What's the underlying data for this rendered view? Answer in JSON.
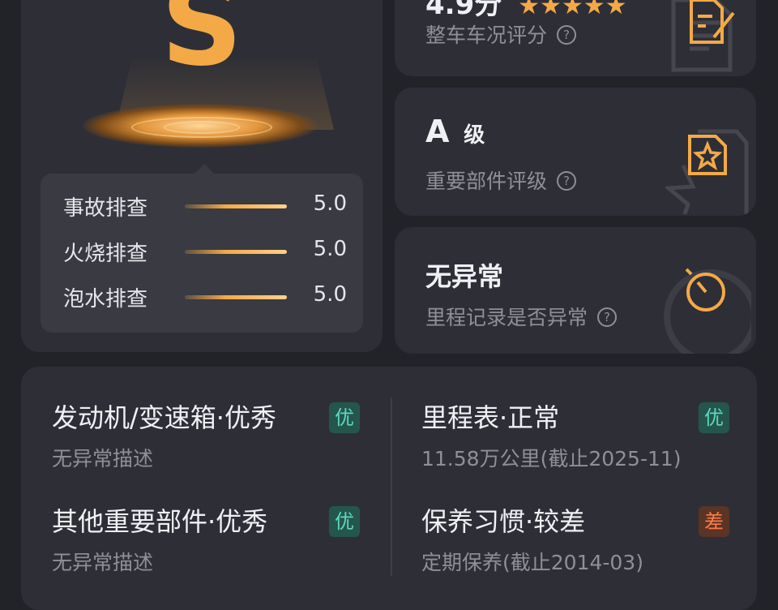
{
  "grade": {
    "letter": "S",
    "checks": [
      {
        "label": "事故排查",
        "score": "5.0"
      },
      {
        "label": "火烧排查",
        "score": "5.0"
      },
      {
        "label": "泡水排查",
        "score": "5.0"
      }
    ]
  },
  "overall": {
    "score_partial": "4.9分",
    "subtitle": "整车车况评分"
  },
  "parts": {
    "title": "A",
    "title_suffix": "级",
    "subtitle": "重要部件评级"
  },
  "mileage_check": {
    "title": "无异常",
    "subtitle": "里程记录是否异常"
  },
  "details": [
    {
      "title": "发动机/变速箱·优秀",
      "desc": "无异常描述",
      "badge": "优",
      "badge_type": "good"
    },
    {
      "title": "里程表·正常",
      "desc": "11.58万公里(截止2025-11)",
      "badge": "优",
      "badge_type": "good"
    },
    {
      "title": "其他重要部件·优秀",
      "desc": "无异常描述",
      "badge": "优",
      "badge_type": "good"
    },
    {
      "title": "保养习惯·较差",
      "desc": "定期保养(截止2014-03)",
      "badge": "差",
      "badge_type": "bad"
    }
  ],
  "colors": {
    "accent": "#f4a947",
    "good_badge": "#5fd8bd",
    "bad_badge": "#ff7a47",
    "background": "#222329",
    "card": "#2e2f36"
  },
  "icons": {
    "overall": "document-edit-icon",
    "parts": "star-document-icon",
    "mileage": "stopwatch-icon",
    "help": "question-circle-icon"
  }
}
